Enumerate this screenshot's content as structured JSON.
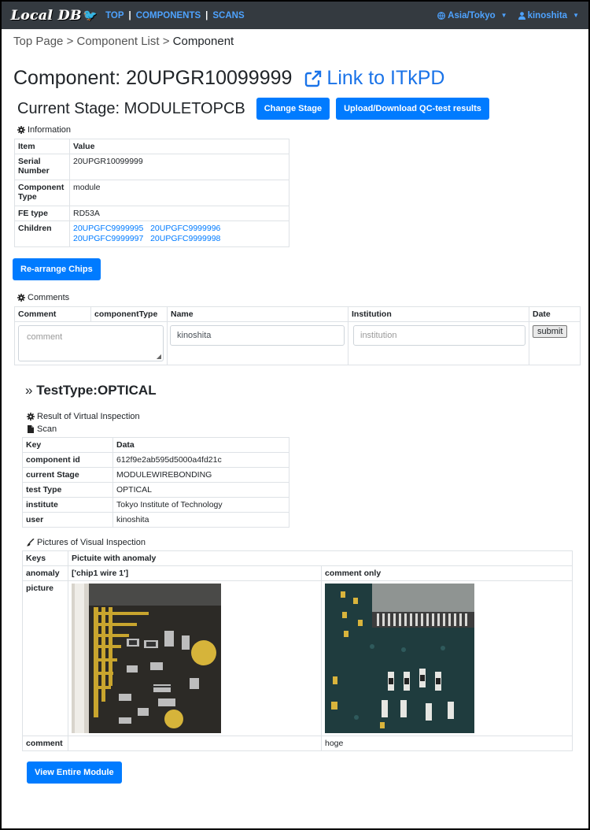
{
  "nav": {
    "brand": "Local DB",
    "links": [
      "TOP",
      "COMPONENTS",
      "SCANS"
    ],
    "timezone": "Asia/Tokyo",
    "user": "kinoshita"
  },
  "breadcrumb": {
    "items": [
      "Top Page",
      "Component List"
    ],
    "current": "Component",
    "separator": ">"
  },
  "title": {
    "component": "Component: 20UPGR10099999",
    "link": "Link to ITkPD"
  },
  "stage": {
    "label": "Current Stage: MODULETOPCB",
    "change_button": "Change Stage",
    "upload_button": "Upload/Download QC-test results"
  },
  "information": {
    "label": "Information",
    "headers": [
      "Item",
      "Value"
    ],
    "serial_label": "Serial Number",
    "serial_value": "20UPGR10099999",
    "type_label": "Component Type",
    "type_value": "module",
    "fe_label": "FE type",
    "fe_value": "RD53A",
    "children_label": "Children",
    "children": [
      "20UPGFC9999995",
      "20UPGFC9999996",
      "20UPGFC9999997",
      "20UPGFC9999998"
    ]
  },
  "rearrange_button": "Re-arrange Chips",
  "comments": {
    "label": "Comments",
    "headers": [
      "Comment",
      "componentType",
      "Name",
      "Institution",
      "Date"
    ],
    "comment_placeholder": "comment",
    "name_value": "kinoshita",
    "institution_placeholder": "institution",
    "submit": "submit"
  },
  "testtype": {
    "arrow": "»",
    "label": "TestType:OPTICAL"
  },
  "virtual": {
    "result_label": "Result of Virtual Inspection",
    "scan_label": "Scan",
    "headers": [
      "Key",
      "Data"
    ],
    "rows": [
      {
        "key": "component id",
        "value": "612f9e2ab595d5000a4fd21c"
      },
      {
        "key": "current Stage",
        "value": "MODULEWIREBONDING"
      },
      {
        "key": "test Type",
        "value": "OPTICAL"
      },
      {
        "key": "institute",
        "value": "Tokyo Institute of Technology"
      },
      {
        "key": "user",
        "value": "kinoshita"
      }
    ]
  },
  "pictures": {
    "label": "Pictures of Visual Inspection",
    "header_keys": "Keys",
    "header_title": "Pictuite with anomaly",
    "anomaly_label": "anomaly",
    "anomaly_1": "['chip1 wire 1']",
    "anomaly_2": "comment only",
    "picture_label": "picture",
    "comment_label": "comment",
    "comment_1": "",
    "comment_2": "hoge"
  },
  "view_button": "View Entire Module",
  "colors": {
    "navbar": "#343a40",
    "primary": "#007bff",
    "link": "#1a73e8"
  }
}
